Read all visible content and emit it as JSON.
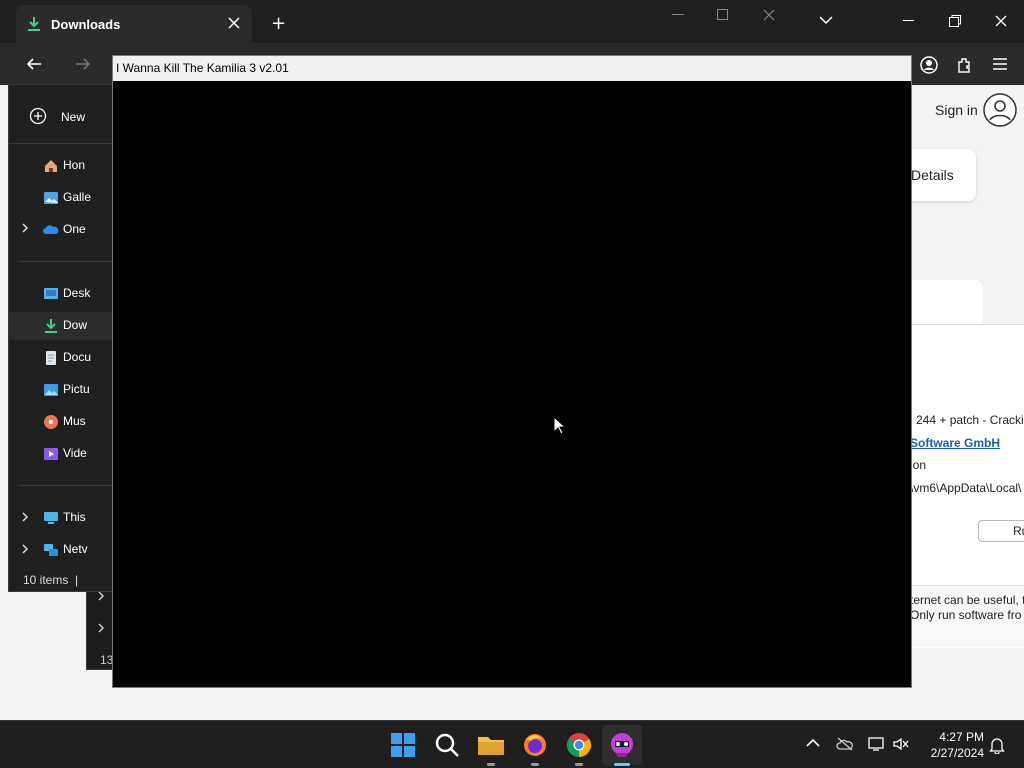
{
  "browser": {
    "tab_title": "Downloads",
    "new_tab_label": "+",
    "sign_in": "Sign in",
    "details_button": "Details",
    "dialog": {
      "line1": "l 244 + patch - Cracki",
      "publisher": "Software GmbH",
      "line3": "ion",
      "path": "\\vm6\\AppData\\Local\\",
      "run_button": "Ru",
      "warning1": "ternet can be useful, t",
      "warning2": "Only run software fro"
    }
  },
  "explorer": {
    "new_button": "New",
    "nav_items": [
      {
        "label": "Hon",
        "icon": "home-icon"
      },
      {
        "label": "Galle",
        "icon": "gallery-icon"
      },
      {
        "label": "One",
        "icon": "onedrive-icon"
      },
      {
        "label": "Desk",
        "icon": "desktop-icon"
      },
      {
        "label": "Dow",
        "icon": "downloads-icon"
      },
      {
        "label": "Docu",
        "icon": "documents-icon"
      },
      {
        "label": "Pictu",
        "icon": "pictures-icon"
      },
      {
        "label": "Mus",
        "icon": "music-icon"
      },
      {
        "label": "Vide",
        "icon": "videos-icon"
      },
      {
        "label": "This",
        "icon": "this-pc-icon"
      },
      {
        "label": "Netv",
        "icon": "network-icon"
      }
    ],
    "status": "10 items",
    "status_sep": "|",
    "back_status": "13"
  },
  "game": {
    "title": "I Wanna Kill The Kamilia 3 v2.01"
  },
  "taskbar": {
    "time": "4:27 PM",
    "date": "2/27/2024"
  },
  "colors": {
    "accent": "#0078d4",
    "link": "#1a5fb4",
    "download_green": "#3fcf8e"
  }
}
